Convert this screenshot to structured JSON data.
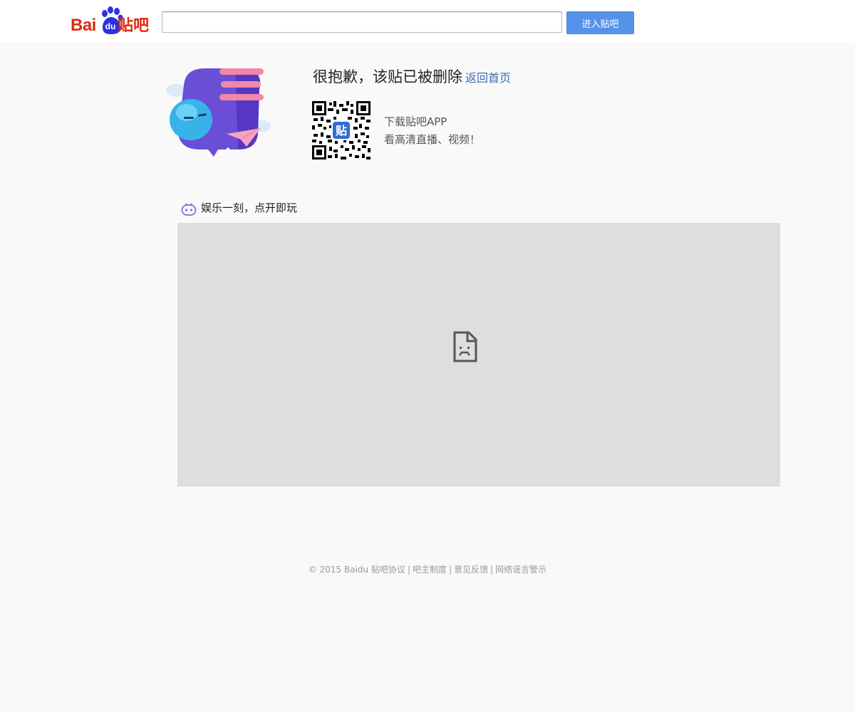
{
  "header": {
    "logo": {
      "bai": "Bai",
      "du": "du",
      "tieba": "贴吧"
    },
    "search": {
      "value": "",
      "placeholder": ""
    },
    "enter_button_label": "进入贴吧"
  },
  "notice": {
    "title": "很抱歉，该贴已被删除",
    "home_link": "返回首页"
  },
  "app_promo": {
    "qr_center_label": "贴",
    "line1": "下载贴吧APP",
    "line2": "看高清直播、视频！"
  },
  "game_section": {
    "title": "娱乐一刻，点开即玩"
  },
  "footer": {
    "copyright": "© 2015 Baidu",
    "links": [
      "贴吧协议",
      "吧主制度",
      "意见反馈",
      "网络谣言警示"
    ],
    "separator": "|"
  },
  "colors": {
    "brand_red": "#de2910",
    "brand_blue": "#2932e1",
    "button_blue": "#5592ea",
    "link_blue": "#3a6fb6",
    "page_bg": "#f9f9f9",
    "frame_bg": "#dedede"
  },
  "icons": {
    "logo_paw": "baidu-paw-icon",
    "illustration": "mascot-illustration",
    "qr": "qr-code-icon",
    "game": "game-controller-icon",
    "broken": "broken-page-icon"
  }
}
